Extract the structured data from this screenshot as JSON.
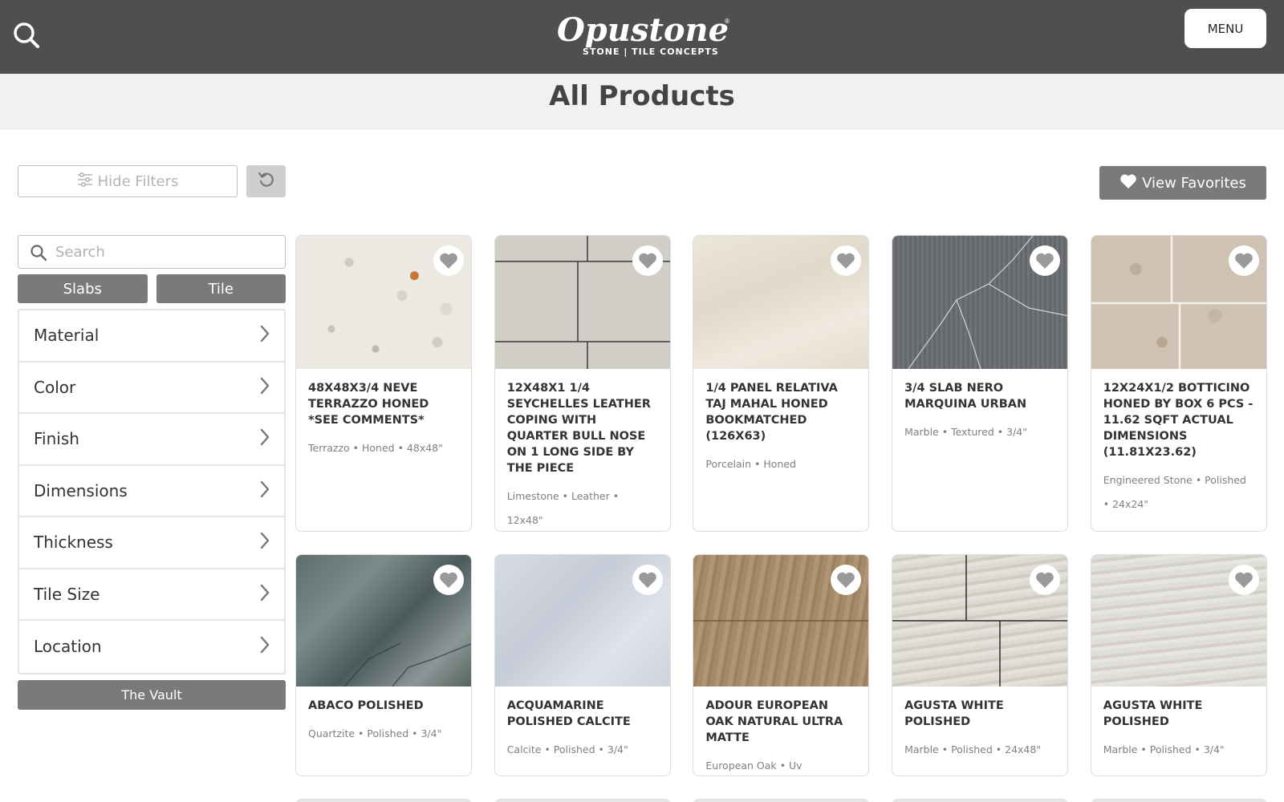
{
  "header": {
    "logo_word": "Opustone",
    "logo_reg": "®",
    "logo_tagline": "STONE | TILE CONCEPTS",
    "menu_label": "MENU"
  },
  "page_title": "All Products",
  "toolbar": {
    "hide_filters_label": "Hide Filters",
    "view_favorites_label": "View Favorites"
  },
  "sidebar": {
    "search_placeholder": "Search",
    "types": [
      "Slabs",
      "Tile"
    ],
    "filters": [
      "Material",
      "Color",
      "Finish",
      "Dimensions",
      "Thickness",
      "Tile Size",
      "Location"
    ],
    "vault_label": "The Vault"
  },
  "products": [
    {
      "title": "48X48X3/4 NEVE TERRAZZO HONED *SEE COMMENTS*",
      "meta": "Terrazzo • Honed • 48x48\"",
      "texture": "terrazzo"
    },
    {
      "title": "12X48X1 1/4 SEYCHELLES LEATHER COPING WITH QUARTER BULL NOSE ON 1 LONG SIDE BY THE PIECE",
      "meta": "Limestone • Leather • 12x48\"",
      "texture": "limestone"
    },
    {
      "title": "1/4 PANEL RELATIVA TAJ MAHAL HONED BOOKMATCHED (126X63)",
      "meta": "Porcelain • Honed",
      "texture": "taj"
    },
    {
      "title": "3/4 SLAB NERO MARQUINA URBAN",
      "meta": "Marble • Textured • 3/4\"",
      "texture": "nero"
    },
    {
      "title": "12X24X1/2 BOTTICINO HONED BY BOX 6 PCS - 11.62 SQFT ACTUAL DIMENSIONS (11.81X23.62)",
      "meta": "Engineered Stone • Polished • 24x24\"",
      "texture": "botticino"
    },
    {
      "title": "ABACO POLISHED",
      "meta": "Quartzite • Polished • 3/4\"",
      "texture": "abaco"
    },
    {
      "title": "ACQUAMARINE POLISHED CALCITE",
      "meta": "Calcite • Polished • 3/4\"",
      "texture": "acqua"
    },
    {
      "title": "ADOUR EUROPEAN OAK NATURAL ULTRA MATTE",
      "meta": "European Oak • Uv",
      "texture": "oak"
    },
    {
      "title": "AGUSTA WHITE POLISHED",
      "meta": "Marble • Polished • 24x48\"",
      "texture": "agusta"
    },
    {
      "title": "AGUSTA WHITE POLISHED",
      "meta": "Marble • Polished • 3/4\"",
      "texture": "agusta2"
    }
  ],
  "colors": {
    "header_bg": "#4f4f4f",
    "title_band_bg": "#f1f1f1",
    "button_gray": "#7a7a7a",
    "reset_gray": "#cfcfcf"
  },
  "icons": {
    "search": "search-icon",
    "filters": "sliders-icon",
    "reset": "undo-icon",
    "favorite": "heart-icon",
    "chevron": "chevron-right-icon"
  }
}
